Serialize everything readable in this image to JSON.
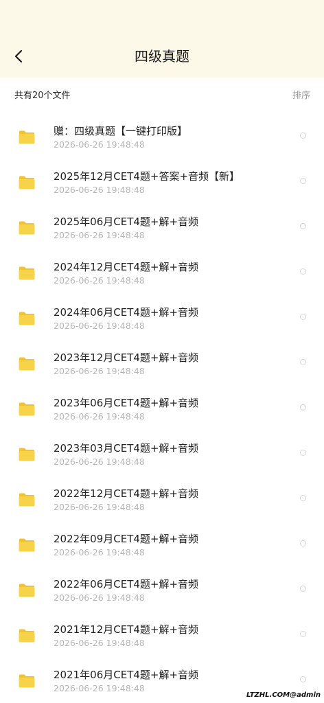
{
  "header": {
    "title": "四级真题",
    "back_icon": "chevron-left-icon"
  },
  "subbar": {
    "file_count": "共有20个文件",
    "sort_label": "排序"
  },
  "colors": {
    "header_bg": "#fdf9e8",
    "folder": "#f7d34a",
    "date_text": "#b7b7b7"
  },
  "files": [
    {
      "name": "赠：四级真题【一键打印版】",
      "date": "2026-06-26  19:48:48"
    },
    {
      "name": "2025年12月CET4题+答案+音频【新】",
      "date": "2026-06-26  19:48:48"
    },
    {
      "name": "2025年06月CET4题+解+音频",
      "date": "2026-06-26  19:48:48"
    },
    {
      "name": "2024年12月CET4题+解+音频",
      "date": "2026-06-26  19:48:48"
    },
    {
      "name": "2024年06月CET4题+解+音频",
      "date": "2026-06-26  19:48:48"
    },
    {
      "name": "2023年12月CET4题+解+音频",
      "date": "2026-06-26  19:48:48"
    },
    {
      "name": "2023年06月CET4题+解+音频",
      "date": "2026-06-26  19:48:48"
    },
    {
      "name": "2023年03月CET4题+解+音频",
      "date": "2026-06-26  19:48:48"
    },
    {
      "name": "2022年12月CET4题+解+音频",
      "date": "2026-06-26  19:48:48"
    },
    {
      "name": "2022年09月CET4题+解+音频",
      "date": "2026-06-26  19:48:48"
    },
    {
      "name": "2022年06月CET4题+解+音频",
      "date": "2026-06-26  19:48:48"
    },
    {
      "name": "2021年12月CET4题+解+音频",
      "date": "2026-06-26  19:48:48"
    },
    {
      "name": "2021年06月CET4题+解+音频",
      "date": "2026-06-26  19:48:48"
    }
  ],
  "watermark": "LTZHL.COM@admin"
}
